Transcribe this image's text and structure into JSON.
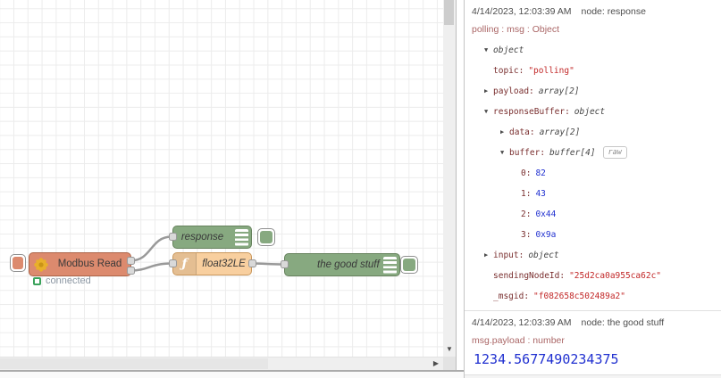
{
  "canvas": {
    "nodes": {
      "modbus": {
        "label": "Modbus Read",
        "status": "connected"
      },
      "response": {
        "label": "response"
      },
      "func": {
        "label": "float32LE",
        "icon_glyph": "ƒ"
      },
      "goodstuff": {
        "label": "the good stuff"
      }
    }
  },
  "icons": {
    "scroll_down": "▼",
    "scroll_right": "▶"
  },
  "colors": {
    "modbus_node": "#dc8a6e",
    "debug_node": "#87a980",
    "function_node": "#f8cf9f",
    "wire": "#999999",
    "status_green": "#3aa25b",
    "tree_key": "#792e2e",
    "tree_string": "#c22828",
    "tree_number": "#2030d0",
    "message_path": "#aa6666"
  },
  "debug": {
    "messages": [
      {
        "timestamp": "4/14/2023, 12:03:39 AM",
        "source": "node: response",
        "path": "polling : msg : Object",
        "rows": [
          {
            "indent": 1,
            "arrow": "▼",
            "key": "",
            "value": "object",
            "vtype": "type"
          },
          {
            "indent": 2,
            "arrow": "",
            "key": "topic:",
            "value": "\"polling\"",
            "vtype": "string"
          },
          {
            "indent": 2,
            "arrow": "▶",
            "key": "payload:",
            "value": "array[2]",
            "vtype": "type"
          },
          {
            "indent": 2,
            "arrow": "▼",
            "key": "responseBuffer:",
            "value": "object",
            "vtype": "type"
          },
          {
            "indent": 3,
            "arrow": "▶",
            "key": "data:",
            "value": "array[2]",
            "vtype": "type"
          },
          {
            "indent": 3,
            "arrow": "▼",
            "key": "buffer:",
            "value": "buffer[4]",
            "vtype": "type",
            "badge": "raw"
          },
          {
            "indent": 4,
            "arrow": "",
            "key": "0:",
            "value": "82",
            "vtype": "number"
          },
          {
            "indent": 4,
            "arrow": "",
            "key": "1:",
            "value": "43",
            "vtype": "number"
          },
          {
            "indent": 4,
            "arrow": "",
            "key": "2:",
            "value": "0x44",
            "vtype": "number"
          },
          {
            "indent": 4,
            "arrow": "",
            "key": "3:",
            "value": "0x9a",
            "vtype": "number"
          },
          {
            "indent": 2,
            "arrow": "▶",
            "key": "input:",
            "value": "object",
            "vtype": "type"
          },
          {
            "indent": 2,
            "arrow": "",
            "key": "sendingNodeId:",
            "value": "\"25d2ca0a955ca62c\"",
            "vtype": "string"
          },
          {
            "indent": 2,
            "arrow": "",
            "key": "_msgid:",
            "value": "\"f082658c502489a2\"",
            "vtype": "string"
          }
        ]
      },
      {
        "timestamp": "4/14/2023, 12:03:39 AM",
        "source": "node: the good stuff",
        "path": "msg.payload : number",
        "value": "1234.5677490234375",
        "value_type": "number"
      }
    ]
  }
}
